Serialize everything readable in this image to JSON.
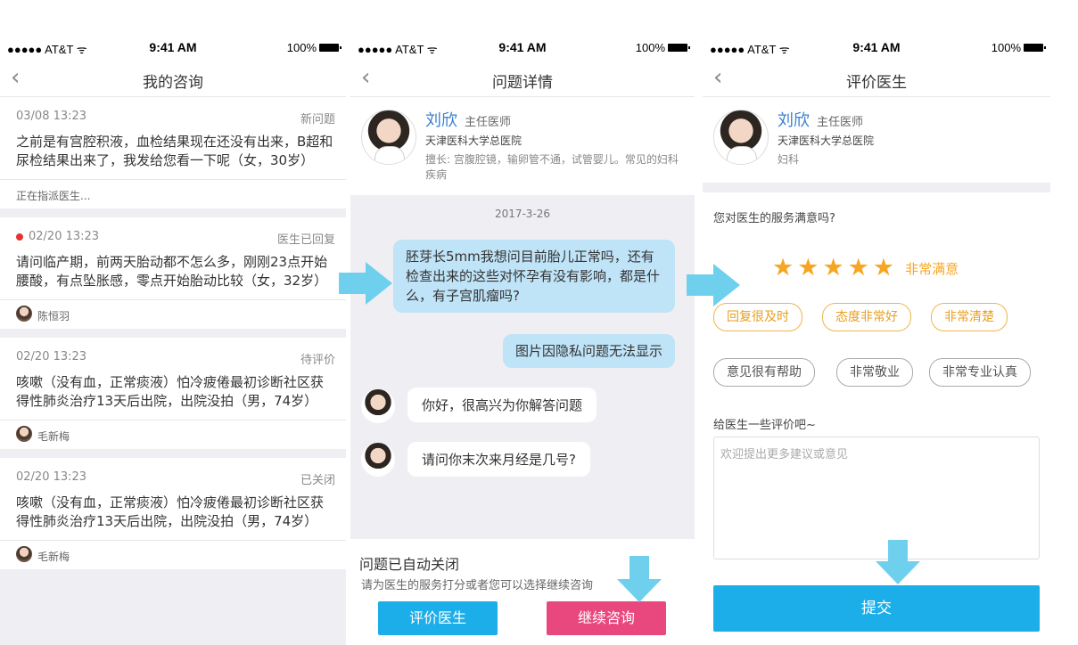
{
  "status": {
    "carrier": "●●●●● AT&T ᯤ",
    "time": "9:41 AM",
    "battery": "100%"
  },
  "screen1": {
    "title": "我的咨询",
    "cards": [
      {
        "date": "03/08  13:23",
        "status": "新问题",
        "text": "之前是有宫腔积液，血检结果现在还没有出来，B超和尿检结果出来了，我发给您看一下呢（女，30岁）",
        "footer": "正在指派医生..."
      },
      {
        "date": "02/20  13:23",
        "status": "医生已回复",
        "text": "请问临产期，前两天胎动都不怎么多，刚刚23点开始腰酸，有点坠胀感，零点开始胎动比较（女，32岁）",
        "doctor": "陈恒羽"
      },
      {
        "date": "02/20  13:23",
        "status": "待评价",
        "text": "咳嗽（没有血，正常痰液）怕冷疲倦最初诊断社区获得性肺炎治疗13天后出院，出院没拍（男，74岁）",
        "doctor": "毛新梅"
      },
      {
        "date": "02/20  13:23",
        "status": "已关闭",
        "text": "咳嗽（没有血，正常痰液）怕冷疲倦最初诊断社区获得性肺炎治疗13天后出院，出院没拍（男，74岁）",
        "doctor": "毛新梅"
      }
    ]
  },
  "screen2": {
    "title": "问题详情",
    "doctor": {
      "name": "刘欣",
      "title": "主任医师",
      "hospital": "天津医科大学总医院",
      "desc": "擅长: 宫腹腔镜，输卵管不通，试管婴儿。常见的妇科疾病"
    },
    "chat_date": "2017-3-26",
    "messages": {
      "m1": "胚芽长5mm我想问目前胎儿正常吗，还有检查出来的这些对怀孕有没有影响，都是什么，有子宫肌瘤吗?",
      "m2": "图片因隐私问题无法显示",
      "m3": "你好，很高兴为你解答问题",
      "m4": "请问你末次来月经是几号?"
    },
    "closed_title": "问题已自动关闭",
    "closed_sub": "请为医生的服务打分或者您可以选择继续咨询",
    "btn_rate": "评价医生",
    "btn_continue": "继续咨询"
  },
  "screen3": {
    "title": "评价医生",
    "doctor": {
      "name": "刘欣",
      "title": "主任医师",
      "hospital": "天津医科大学总医院",
      "dept": "妇科"
    },
    "question": "您对医生的服务满意吗?",
    "rating": 5,
    "rating_label": "非常满意",
    "tags": [
      "回复很及时",
      "态度非常好",
      "非常清楚",
      "意见很有帮助",
      "非常敬业",
      "非常专业认真"
    ],
    "comment_title": "给医生一些评价吧~",
    "comment_placeholder": "欢迎提出更多建议或意见",
    "submit": "提交"
  },
  "colors": {
    "accent": "#1caee8",
    "pink": "#e9487f",
    "star": "#f6a622",
    "arrow": "#6fd0ee"
  }
}
